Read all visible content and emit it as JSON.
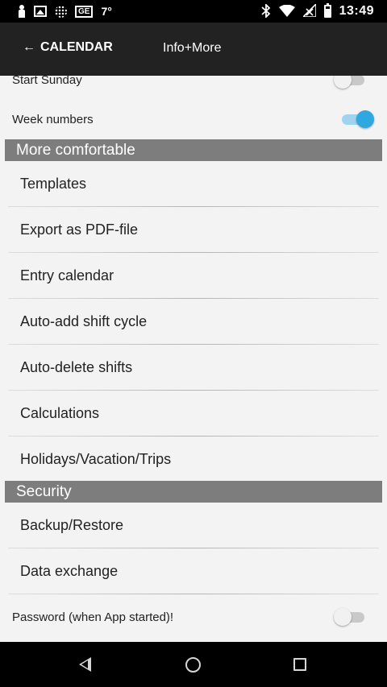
{
  "status_bar": {
    "ge_label": "GE",
    "temperature": "7°",
    "time": "13:49"
  },
  "app_bar": {
    "back_label": "CALENDAR",
    "back_arrow": "←",
    "title": "Info+More"
  },
  "settings": {
    "start_sunday": {
      "label": "Start Sunday",
      "on": false
    },
    "week_numbers": {
      "label": "Week numbers",
      "on": true
    },
    "password": {
      "label": "Password (when App started)!",
      "on": false
    }
  },
  "sections": {
    "comfortable": {
      "title": "More comfortable",
      "items": [
        "Templates",
        "Export as PDF-file",
        "Entry calendar",
        "Auto-add shift cycle",
        "Auto-delete shifts",
        "Calculations",
        "Holidays/Vacation/Trips"
      ]
    },
    "security": {
      "title": "Security",
      "items": [
        "Backup/Restore",
        "Data exchange"
      ]
    }
  },
  "colors": {
    "app_bar": "#222222",
    "section_header": "#7d7d7d",
    "switch_on": "#2fa7e0",
    "background": "#f3f3f3"
  }
}
